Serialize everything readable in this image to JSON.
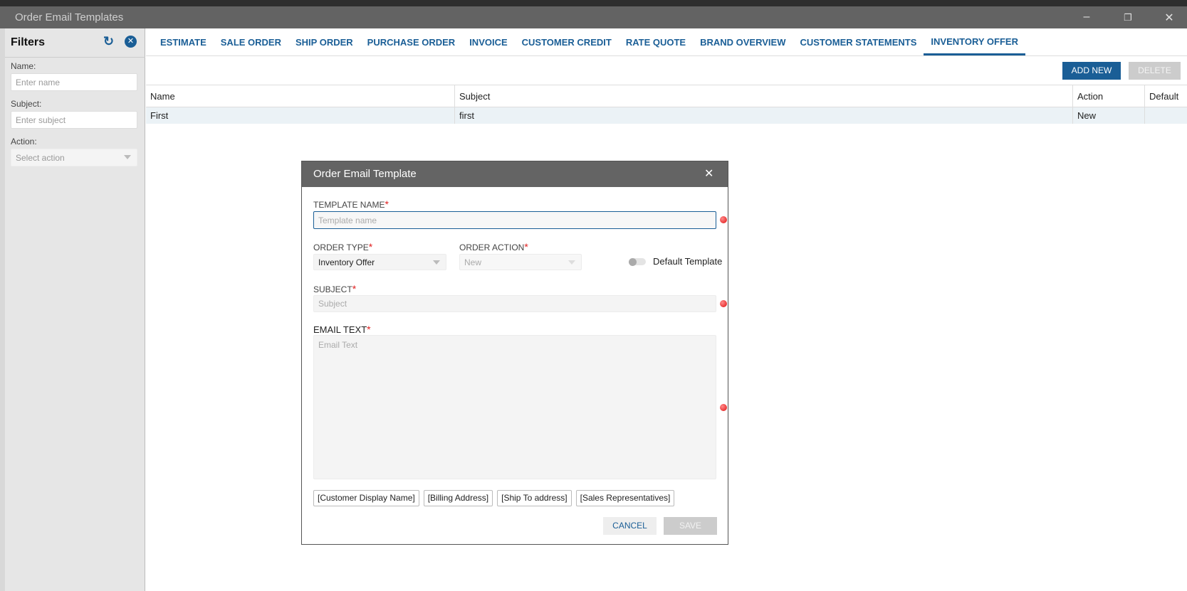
{
  "window": {
    "title": "Order Email Templates",
    "minimize_icon": "minimize-icon",
    "restore_icon": "restore-icon",
    "close_icon": "close-icon"
  },
  "sidebar": {
    "title": "Filters",
    "name_label": "Name:",
    "name_placeholder": "Enter name",
    "subject_label": "Subject:",
    "subject_placeholder": "Enter subject",
    "action_label": "Action:",
    "action_placeholder": "Select action"
  },
  "tabs": [
    "ESTIMATE",
    "SALE ORDER",
    "SHIP ORDER",
    "PURCHASE ORDER",
    "INVOICE",
    "CUSTOMER CREDIT",
    "RATE QUOTE",
    "BRAND OVERVIEW",
    "CUSTOMER STATEMENTS",
    "INVENTORY OFFER"
  ],
  "active_tab": "INVENTORY OFFER",
  "toolbar": {
    "add_new": "ADD NEW",
    "delete": "DELETE"
  },
  "table": {
    "columns": [
      "Name",
      "Subject",
      "Action",
      "Default"
    ],
    "rows": [
      {
        "name": "First",
        "subject": "first",
        "action": "New",
        "default": ""
      }
    ]
  },
  "dialog": {
    "title": "Order Email Template",
    "template_name_label": "TEMPLATE NAME",
    "template_name_placeholder": "Template name",
    "order_type_label": "ORDER TYPE",
    "order_type_value": "Inventory Offer",
    "order_action_label": "ORDER ACTION",
    "order_action_value": "New",
    "default_template_label": "Default Template",
    "default_template_on": false,
    "subject_label": "SUBJECT",
    "subject_placeholder": "Subject",
    "email_text_label": "EMAIL TEXT",
    "email_text_placeholder": "Email Text",
    "required_mark": "*",
    "placeholders": [
      "[Customer Display Name]",
      "[Billing Address]",
      "[Ship To address]",
      "[Sales Representatives]"
    ],
    "cancel": "CANCEL",
    "save": "SAVE"
  },
  "colors": {
    "accent": "#1a5e96",
    "titlebar": "#636363",
    "required": "#e02020"
  }
}
